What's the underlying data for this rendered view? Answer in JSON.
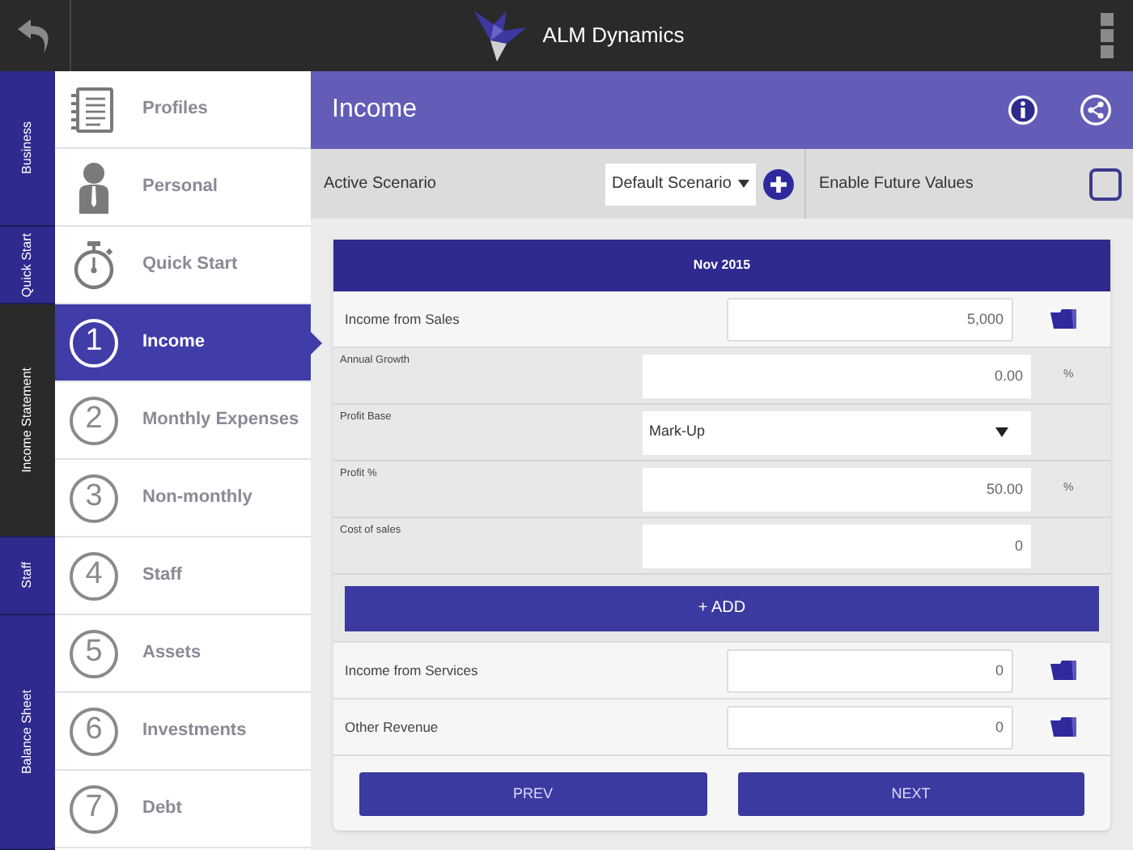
{
  "app": {
    "title": "ALM Dynamics"
  },
  "sections": [
    {
      "label": "Business",
      "selected": false
    },
    {
      "label": "Quick Start",
      "selected": false
    },
    {
      "label": "Income Statement",
      "selected": true
    },
    {
      "label": "Staff",
      "selected": false
    },
    {
      "label": "Balance Sheet",
      "selected": false
    }
  ],
  "nav": [
    {
      "label": "Profiles",
      "kind": "notepad",
      "selected": false
    },
    {
      "label": "Personal",
      "kind": "person",
      "selected": false
    },
    {
      "label": "Quick Start",
      "kind": "stopwatch",
      "selected": false
    },
    {
      "label": "Income",
      "kind": "number",
      "number": "1",
      "selected": true
    },
    {
      "label": "Monthly Expenses",
      "kind": "number",
      "number": "2",
      "selected": false
    },
    {
      "label": "Non-monthly",
      "kind": "number",
      "number": "3",
      "selected": false
    },
    {
      "label": "Staff",
      "kind": "number",
      "number": "4",
      "selected": false
    },
    {
      "label": "Assets",
      "kind": "number",
      "number": "5",
      "selected": false
    },
    {
      "label": "Investments",
      "kind": "number",
      "number": "6",
      "selected": false
    },
    {
      "label": "Debt",
      "kind": "number",
      "number": "7",
      "selected": false
    }
  ],
  "page": {
    "title": "Income"
  },
  "scenario": {
    "label": "Active Scenario",
    "value": "Default Scenario",
    "future_label": "Enable Future Values",
    "future_checked": false
  },
  "period": "Nov 2015",
  "rows": [
    {
      "kind": "main",
      "label": "Income from Sales",
      "value": "5,000"
    },
    {
      "kind": "sub",
      "label": "Annual Growth",
      "value": "0.00",
      "unit": "%"
    },
    {
      "kind": "select",
      "label": "Profit Base",
      "value": "Mark-Up"
    },
    {
      "kind": "sub",
      "label": "Profit %",
      "value": "50.00",
      "unit": "%"
    },
    {
      "kind": "sub",
      "label": "Cost of sales",
      "value": "0"
    },
    {
      "kind": "add",
      "label": "+ ADD"
    },
    {
      "kind": "main",
      "label": "Income from Services",
      "value": "0"
    },
    {
      "kind": "main",
      "label": "Other Revenue",
      "value": "0"
    }
  ],
  "buttons": [
    "PREV",
    "NEXT"
  ]
}
